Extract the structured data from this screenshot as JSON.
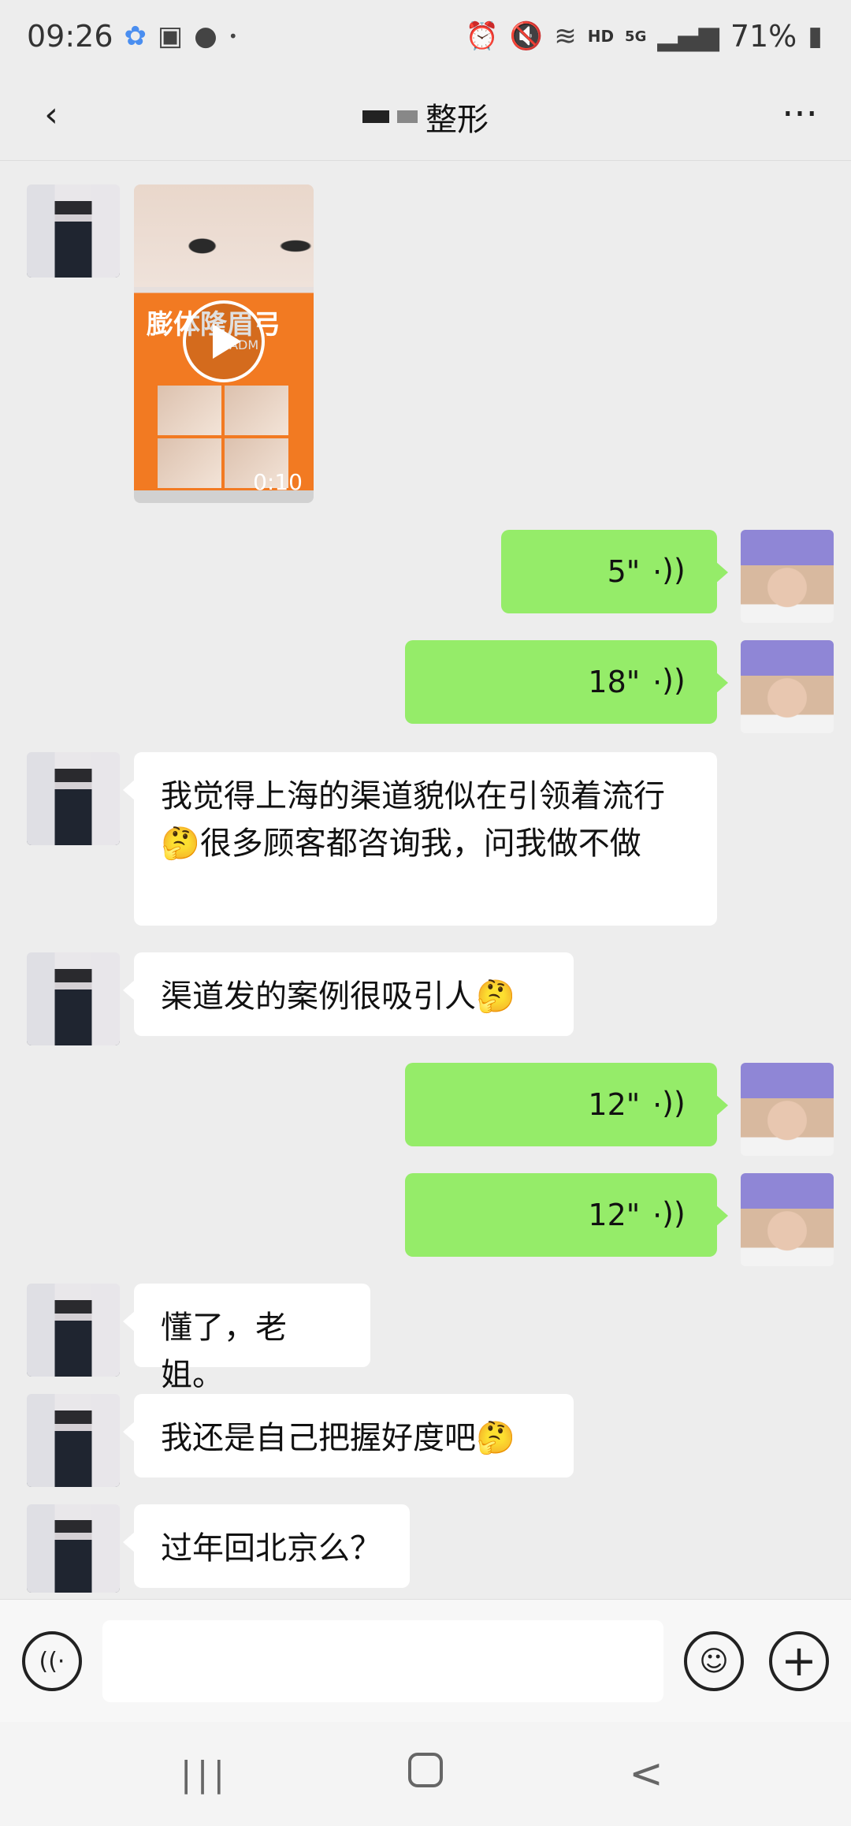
{
  "status_bar": {
    "time": "09:26",
    "left_icons": [
      "baidu-netdisk-icon",
      "gallery-icon",
      "wechat-icon",
      "dot-icon"
    ],
    "hd_label": "HD",
    "network_label": "5G",
    "battery": "71%"
  },
  "header": {
    "title": "整形",
    "back_glyph": "‹",
    "more_glyph": "···"
  },
  "messages": {
    "video": {
      "duration": "0:10",
      "heading": "膨体隆眉弓",
      "sub": "人 ADM"
    },
    "voice1": {
      "duration": "5\""
    },
    "voice2": {
      "duration": "18\""
    },
    "text1": {
      "text": "我觉得上海的渠道貌似在引领着流行",
      "emoji": "🤔",
      "text_after": "很多顾客都咨询我，问我做不做"
    },
    "text2": {
      "text": "渠道发的案例很吸引人",
      "emoji": "🤔"
    },
    "voice3": {
      "duration": "12\""
    },
    "voice4": {
      "duration": "12\""
    },
    "text3": {
      "text": "懂了，老姐。"
    },
    "text4": {
      "text": "我还是自己把握好度吧",
      "emoji": "🤔"
    },
    "text5": {
      "text": "过年回北京么？"
    }
  },
  "input_bar": {
    "placeholder": ""
  },
  "nav_bar": {
    "recents_glyph": "|||",
    "back_glyph": "<"
  },
  "colors": {
    "green_bubble": "#95ec69",
    "background": "#ededed"
  }
}
